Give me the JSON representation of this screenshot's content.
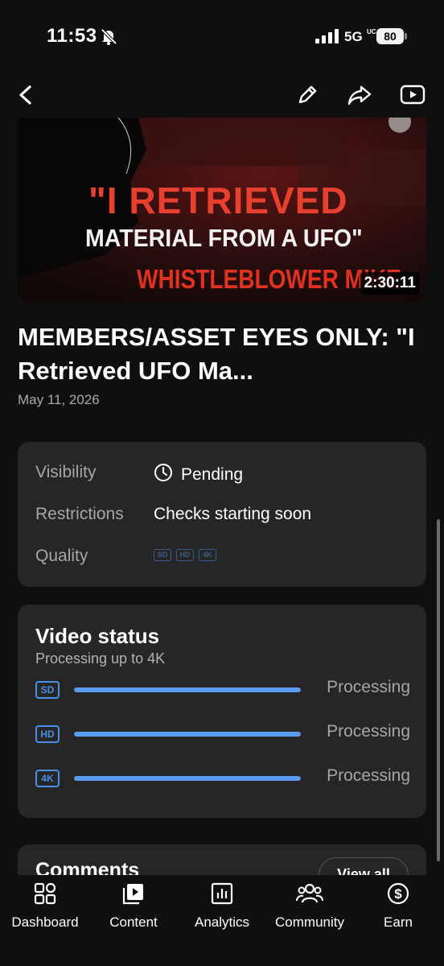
{
  "status_bar": {
    "time": "11:53",
    "network": "5G",
    "network_sub": "UC",
    "battery": "80"
  },
  "header": {
    "icons": [
      "back-arrow-icon",
      "edit-pencil-icon",
      "share-icon",
      "youtube-play-icon"
    ]
  },
  "video": {
    "thumbnail_text": {
      "line1": "\"I RETRIEVED",
      "line2": "MATERIAL FROM A UFO\"",
      "line3": "WHISTLEBLOWER MIKE"
    },
    "duration": "2:30:11",
    "title": "MEMBERS/ASSET EYES ONLY: \"I Retrieved UFO Ma...",
    "date": "May 11, 2026"
  },
  "details": {
    "visibility_label": "Visibility",
    "visibility_value": "Pending",
    "restrictions_label": "Restrictions",
    "restrictions_value": "Checks starting soon",
    "quality_label": "Quality",
    "quality_badges": [
      "SD",
      "HD",
      "4K"
    ]
  },
  "video_status": {
    "title": "Video status",
    "subtitle": "Processing up to 4K",
    "rows": [
      {
        "badge": "SD",
        "status": "Processing",
        "progress": 1.0
      },
      {
        "badge": "HD",
        "status": "Processing",
        "progress": 1.0
      },
      {
        "badge": "4K",
        "status": "Processing",
        "progress": 1.0
      }
    ],
    "accent_color": "#4a8ee8"
  },
  "comments": {
    "title": "Comments",
    "view_all": "View all"
  },
  "bottom_nav": {
    "items": [
      {
        "label": "Dashboard",
        "icon": "dashboard-icon"
      },
      {
        "label": "Content",
        "icon": "content-icon"
      },
      {
        "label": "Analytics",
        "icon": "analytics-icon"
      },
      {
        "label": "Community",
        "icon": "community-icon"
      },
      {
        "label": "Earn",
        "icon": "earn-icon"
      }
    ]
  }
}
